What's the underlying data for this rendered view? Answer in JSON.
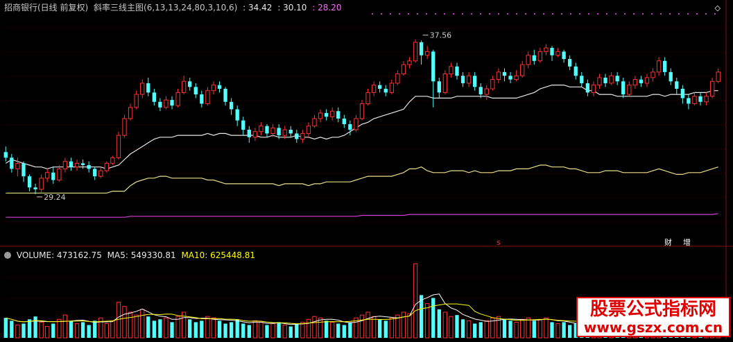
{
  "header": {
    "stock_name": "招商银行(日线 前复权)",
    "indicator_name": "斜率三线主图(6,13,13,24,80,3,10,6)",
    "value1": ": 34.42",
    "value2": ": 30.10",
    "value3": ": 28.20",
    "corner_icon": "chevron-up-icon"
  },
  "volume_header": {
    "volume": "VOLUME: 473162.75",
    "ma5": "MA5: 549330.81",
    "ma10": "MA10: 625448.81"
  },
  "badges": {
    "s_marker": "s",
    "cai": "财",
    "zeng": "增"
  },
  "watermark": {
    "line1": "股票公式指标网",
    "line2": "www.gszx.com.cn"
  },
  "colors": {
    "up": "#ff3232",
    "down": "#54fcfc",
    "white_line": "#e8e8e8",
    "yellow_line": "#e8e08a",
    "magenta_line": "#d33ed3",
    "vol_ma5": "#ffffff",
    "vol_ma10": "#ffff00",
    "header_white": "#c8c8c8",
    "header_purple": "#ff66ff"
  },
  "chart_data": {
    "type": "candlestick",
    "price_range": [
      27.0,
      39.0
    ],
    "annotations": [
      {
        "text": "37.56",
        "index": 70,
        "value": 37.56,
        "kind": "high"
      },
      {
        "text": "29.24",
        "index": 5,
        "value": 29.24,
        "kind": "low"
      }
    ],
    "candles": [
      [
        31.5,
        31.2,
        31.8,
        31.0
      ],
      [
        31.2,
        30.6,
        31.4,
        30.4
      ],
      [
        30.6,
        30.9,
        31.2,
        30.2
      ],
      [
        30.9,
        30.2,
        31.0,
        29.9
      ],
      [
        30.2,
        29.6,
        30.3,
        29.4
      ],
      [
        29.6,
        29.5,
        29.8,
        29.24
      ],
      [
        29.5,
        30.1,
        30.3,
        29.3
      ],
      [
        30.1,
        30.4,
        30.6,
        29.9
      ],
      [
        30.4,
        30.0,
        30.7,
        29.8
      ],
      [
        30.0,
        30.6,
        30.8,
        29.9
      ],
      [
        30.6,
        31.0,
        31.2,
        30.4
      ],
      [
        31.0,
        30.7,
        31.2,
        30.5
      ],
      [
        30.7,
        30.9,
        31.1,
        30.5
      ],
      [
        30.9,
        30.8,
        31.1,
        30.6
      ],
      [
        30.8,
        30.6,
        31.0,
        30.4
      ],
      [
        30.6,
        30.2,
        30.7,
        30.0
      ],
      [
        30.2,
        30.5,
        30.7,
        30.1
      ],
      [
        30.5,
        30.9,
        31.0,
        30.4
      ],
      [
        30.9,
        31.2,
        31.3,
        30.8
      ],
      [
        31.2,
        32.4,
        32.6,
        31.1
      ],
      [
        32.4,
        33.3,
        33.5,
        32.3
      ],
      [
        33.3,
        33.9,
        34.1,
        33.2
      ],
      [
        33.9,
        34.6,
        34.8,
        33.8
      ],
      [
        34.6,
        35.2,
        35.4,
        34.4
      ],
      [
        35.2,
        34.7,
        35.5,
        34.5
      ],
      [
        34.7,
        34.2,
        34.9,
        34.0
      ],
      [
        34.2,
        33.9,
        34.4,
        33.7
      ],
      [
        33.9,
        34.3,
        34.5,
        33.8
      ],
      [
        34.3,
        34.0,
        34.5,
        33.8
      ],
      [
        34.0,
        34.7,
        34.9,
        33.9
      ],
      [
        34.7,
        35.3,
        35.6,
        34.6
      ],
      [
        35.3,
        35.0,
        35.5,
        34.8
      ],
      [
        35.0,
        34.6,
        35.2,
        34.4
      ],
      [
        34.6,
        34.1,
        34.8,
        33.9
      ],
      [
        34.1,
        34.8,
        35.0,
        34.0
      ],
      [
        34.8,
        35.1,
        35.3,
        34.6
      ],
      [
        35.1,
        34.9,
        35.3,
        34.7
      ],
      [
        34.9,
        34.2,
        35.0,
        34.0
      ],
      [
        34.2,
        33.8,
        34.4,
        33.5
      ],
      [
        33.8,
        33.2,
        34.0,
        32.9
      ],
      [
        33.2,
        32.7,
        33.4,
        32.4
      ],
      [
        32.7,
        32.3,
        32.9,
        32.0
      ],
      [
        32.3,
        32.6,
        32.8,
        32.1
      ],
      [
        32.6,
        32.9,
        33.1,
        32.4
      ],
      [
        32.9,
        32.5,
        33.0,
        32.3
      ],
      [
        32.5,
        32.8,
        33.0,
        32.3
      ],
      [
        32.8,
        32.4,
        33.0,
        32.2
      ],
      [
        32.4,
        32.7,
        32.9,
        32.2
      ],
      [
        32.7,
        32.5,
        32.9,
        32.3
      ],
      [
        32.5,
        32.2,
        32.7,
        32.0
      ],
      [
        32.2,
        32.5,
        32.7,
        32.0
      ],
      [
        32.5,
        32.9,
        33.1,
        32.3
      ],
      [
        32.9,
        33.3,
        33.5,
        32.8
      ],
      [
        33.3,
        33.6,
        33.8,
        33.1
      ],
      [
        33.6,
        33.4,
        33.8,
        33.2
      ],
      [
        33.4,
        33.7,
        33.9,
        33.2
      ],
      [
        33.7,
        33.3,
        33.9,
        33.1
      ],
      [
        33.3,
        33.0,
        33.5,
        32.8
      ],
      [
        33.0,
        32.7,
        33.2,
        32.4
      ],
      [
        32.7,
        33.3,
        33.5,
        32.6
      ],
      [
        33.3,
        34.1,
        34.3,
        33.2
      ],
      [
        34.1,
        34.7,
        34.9,
        34.0
      ],
      [
        34.7,
        35.1,
        35.3,
        34.5
      ],
      [
        35.1,
        34.9,
        35.3,
        34.7
      ],
      [
        34.9,
        34.7,
        35.1,
        34.5
      ],
      [
        34.7,
        35.2,
        35.4,
        34.6
      ],
      [
        35.2,
        35.7,
        35.9,
        35.1
      ],
      [
        35.7,
        36.2,
        36.4,
        35.6
      ],
      [
        36.2,
        36.4,
        36.6,
        36.0
      ],
      [
        36.4,
        37.4,
        37.56,
        36.3
      ],
      [
        37.4,
        36.7,
        37.5,
        36.2
      ],
      [
        36.7,
        36.9,
        37.2,
        36.5
      ],
      [
        36.9,
        35.3,
        37.0,
        33.9
      ],
      [
        35.3,
        34.7,
        35.5,
        34.4
      ],
      [
        34.7,
        35.7,
        35.9,
        34.6
      ],
      [
        35.7,
        36.1,
        36.3,
        35.5
      ],
      [
        36.1,
        35.6,
        36.3,
        35.4
      ],
      [
        35.6,
        35.2,
        35.8,
        35.0
      ],
      [
        35.2,
        35.6,
        35.8,
        35.0
      ],
      [
        35.6,
        35.0,
        35.8,
        34.8
      ],
      [
        35.0,
        34.6,
        35.2,
        34.4
      ],
      [
        34.6,
        34.9,
        35.1,
        34.3
      ],
      [
        34.9,
        35.4,
        35.6,
        34.8
      ],
      [
        35.4,
        35.8,
        36.0,
        35.2
      ],
      [
        35.8,
        35.6,
        36.0,
        35.3
      ],
      [
        35.6,
        35.4,
        35.8,
        35.2
      ],
      [
        35.4,
        35.6,
        35.9,
        35.3
      ],
      [
        35.6,
        36.2,
        36.4,
        35.5
      ],
      [
        36.2,
        36.7,
        36.9,
        36.0
      ],
      [
        36.7,
        36.4,
        37.0,
        36.2
      ],
      [
        36.4,
        36.9,
        37.1,
        36.3
      ],
      [
        36.9,
        37.1,
        37.3,
        36.7
      ],
      [
        37.1,
        36.7,
        37.2,
        36.4
      ],
      [
        36.7,
        36.9,
        37.1,
        36.6
      ],
      [
        36.9,
        36.5,
        37.0,
        36.3
      ],
      [
        36.5,
        36.1,
        36.7,
        35.9
      ],
      [
        36.1,
        35.6,
        36.3,
        35.4
      ],
      [
        35.6,
        35.2,
        35.8,
        35.0
      ],
      [
        35.2,
        34.7,
        35.4,
        34.5
      ],
      [
        34.7,
        35.1,
        35.3,
        34.5
      ],
      [
        35.1,
        35.5,
        35.7,
        34.9
      ],
      [
        35.5,
        35.2,
        35.7,
        35.0
      ],
      [
        35.2,
        35.6,
        35.8,
        35.1
      ],
      [
        35.6,
        35.3,
        35.8,
        35.1
      ],
      [
        35.3,
        34.6,
        35.5,
        34.4
      ],
      [
        34.6,
        35.1,
        35.3,
        34.5
      ],
      [
        35.1,
        35.4,
        35.6,
        34.9
      ],
      [
        35.4,
        35.2,
        35.6,
        35.0
      ],
      [
        35.2,
        35.5,
        35.7,
        35.0
      ],
      [
        35.5,
        35.8,
        36.0,
        35.3
      ],
      [
        35.8,
        36.4,
        36.6,
        35.6
      ],
      [
        36.4,
        35.8,
        36.6,
        35.6
      ],
      [
        35.8,
        35.3,
        36.0,
        35.1
      ],
      [
        35.3,
        34.9,
        35.5,
        34.6
      ],
      [
        34.9,
        34.4,
        35.1,
        34.1
      ],
      [
        34.4,
        34.1,
        34.6,
        33.8
      ],
      [
        34.1,
        34.5,
        34.7,
        34.0
      ],
      [
        34.5,
        34.2,
        34.7,
        34.0
      ],
      [
        34.2,
        34.5,
        34.7,
        34.0
      ],
      [
        34.5,
        35.3,
        35.5,
        34.4
      ],
      [
        35.3,
        35.8,
        36.0,
        35.2
      ]
    ],
    "lines": [
      {
        "color": "white",
        "values": [
          30.9,
          31.1,
          31.0,
          30.9,
          30.8,
          30.7,
          30.7,
          30.6,
          30.7,
          30.7,
          30.7,
          30.7,
          30.7,
          30.7,
          30.7,
          30.7,
          30.7,
          30.6,
          30.7,
          30.8,
          31.1,
          31.4,
          31.6,
          31.8,
          32.0,
          32.2,
          32.3,
          32.3,
          32.3,
          32.4,
          32.4,
          32.4,
          32.4,
          32.4,
          32.5,
          32.4,
          32.5,
          32.5,
          32.4,
          32.4,
          32.4,
          32.4,
          32.4,
          32.3,
          32.3,
          32.4,
          32.3,
          32.3,
          32.3,
          32.4,
          32.3,
          32.3,
          32.2,
          32.3,
          32.2,
          32.3,
          32.3,
          32.4,
          32.6,
          32.8,
          33.0,
          33.1,
          33.3,
          33.4,
          33.5,
          33.6,
          33.7,
          33.8,
          34.2,
          34.5,
          34.5,
          34.5,
          34.4,
          34.4,
          34.4,
          34.4,
          34.5,
          34.5,
          34.5,
          34.5,
          34.5,
          34.5,
          34.4,
          34.4,
          34.4,
          34.4,
          34.4,
          34.5,
          34.6,
          34.7,
          34.9,
          35.0,
          35.1,
          35.1,
          35.1,
          35.0,
          35.0,
          35.0,
          34.8,
          34.8,
          34.6,
          34.6,
          34.6,
          34.5,
          34.5,
          34.5,
          34.5,
          34.5,
          34.5,
          34.6,
          34.6,
          34.5,
          34.6,
          34.6,
          34.6,
          34.6,
          34.7,
          34.7,
          34.7,
          34.8,
          34.8
        ]
      },
      {
        "color": "yellow",
        "values": [
          29.3,
          29.3,
          29.3,
          29.3,
          29.3,
          29.3,
          29.3,
          29.3,
          29.3,
          29.3,
          29.3,
          29.3,
          29.3,
          29.3,
          29.3,
          29.3,
          29.3,
          29.3,
          29.4,
          29.4,
          29.4,
          29.7,
          29.9,
          30.0,
          30.1,
          30.1,
          30.2,
          30.2,
          30.1,
          30.1,
          30.1,
          30.1,
          30.1,
          30.1,
          30.0,
          30.0,
          29.9,
          29.8,
          29.8,
          29.8,
          29.8,
          29.8,
          29.8,
          29.8,
          29.8,
          29.8,
          29.7,
          29.8,
          29.8,
          29.8,
          29.8,
          29.7,
          29.8,
          29.8,
          29.9,
          29.9,
          29.9,
          29.9,
          29.9,
          30.0,
          30.1,
          30.2,
          30.2,
          30.2,
          30.2,
          30.2,
          30.3,
          30.4,
          30.6,
          30.6,
          30.7,
          30.5,
          30.4,
          30.4,
          30.4,
          30.5,
          30.5,
          30.5,
          30.4,
          30.5,
          30.4,
          30.4,
          30.4,
          30.5,
          30.5,
          30.5,
          30.6,
          30.6,
          30.6,
          30.7,
          30.8,
          30.8,
          30.7,
          30.7,
          30.7,
          30.6,
          30.6,
          30.5,
          30.4,
          30.4,
          30.4,
          30.5,
          30.5,
          30.5,
          30.4,
          30.4,
          30.4,
          30.4,
          30.4,
          30.5,
          30.6,
          30.5,
          30.4,
          30.3,
          30.3,
          30.4,
          30.4,
          30.4,
          30.5,
          30.6,
          30.7
        ]
      },
      {
        "color": "magenta",
        "values": [
          28.0,
          28.0,
          28.0,
          28.0,
          28.0,
          28.0,
          28.0,
          28.0,
          28.0,
          28.0,
          28.0,
          28.0,
          28.0,
          28.0,
          28.0,
          28.0,
          28.0,
          28.0,
          28.0,
          28.0,
          28.0,
          28.05,
          28.05,
          28.05,
          28.05,
          28.05,
          28.05,
          28.05,
          28.05,
          28.05,
          28.05,
          28.05,
          28.05,
          28.05,
          28.05,
          28.05,
          28.05,
          28.05,
          28.05,
          28.05,
          28.05,
          28.05,
          28.05,
          28.05,
          28.05,
          28.05,
          28.05,
          28.05,
          28.05,
          28.05,
          28.05,
          28.05,
          28.05,
          28.05,
          28.05,
          28.05,
          28.05,
          28.05,
          28.05,
          28.05,
          28.1,
          28.1,
          28.1,
          28.1,
          28.1,
          28.1,
          28.1,
          28.1,
          28.15,
          28.15,
          28.15,
          28.15,
          28.15,
          28.15,
          28.15,
          28.15,
          28.15,
          28.15,
          28.15,
          28.15,
          28.15,
          28.15,
          28.15,
          28.15,
          28.15,
          28.15,
          28.15,
          28.15,
          28.15,
          28.15,
          28.15,
          28.15,
          28.15,
          28.15,
          28.15,
          28.15,
          28.15,
          28.15,
          28.15,
          28.15,
          28.15,
          28.15,
          28.15,
          28.15,
          28.15,
          28.15,
          28.15,
          28.15,
          28.15,
          28.15,
          28.15,
          28.15,
          28.15,
          28.15,
          28.15,
          28.15,
          28.15,
          28.15,
          28.15,
          28.15,
          28.2
        ]
      }
    ],
    "volume": [
      1.4,
      1.2,
      0.9,
      1.0,
      1.3,
      1.5,
      1.1,
      0.8,
      1.0,
      1.3,
      1.6,
      1.2,
      1.0,
      1.1,
      0.9,
      1.2,
      1.4,
      1.0,
      1.2,
      2.5,
      2.2,
      1.8,
      1.6,
      2.0,
      1.5,
      1.2,
      1.3,
      1.4,
      1.1,
      1.5,
      1.8,
      1.3,
      1.1,
      1.2,
      1.5,
      1.4,
      1.2,
      1.0,
      1.1,
      1.3,
      1.0,
      0.9,
      1.2,
      1.1,
      0.9,
      1.0,
      1.1,
      0.9,
      0.8,
      1.0,
      1.1,
      1.3,
      1.5,
      1.4,
      1.2,
      1.1,
      1.0,
      0.9,
      1.1,
      1.4,
      1.6,
      1.8,
      1.5,
      1.3,
      1.2,
      1.4,
      1.6,
      1.8,
      1.7,
      5.2,
      3.0,
      2.4,
      2.8,
      2.0,
      1.8,
      1.5,
      1.6,
      1.3,
      1.2,
      1.0,
      1.1,
      1.2,
      1.4,
      1.5,
      1.3,
      1.2,
      1.1,
      1.3,
      1.4,
      1.2,
      1.3,
      1.4,
      1.1,
      1.0,
      1.1,
      0.9,
      1.0,
      1.1,
      1.2,
      1.0,
      1.2,
      1.1,
      1.0,
      0.9,
      1.1,
      1.0,
      1.2,
      1.1,
      1.0,
      1.2,
      1.3,
      1.1,
      1.0,
      0.9,
      1.2,
      1.0,
      1.1,
      1.2,
      1.0,
      1.1,
      1.3
    ],
    "volume_range": [
      0,
      5.6
    ]
  }
}
